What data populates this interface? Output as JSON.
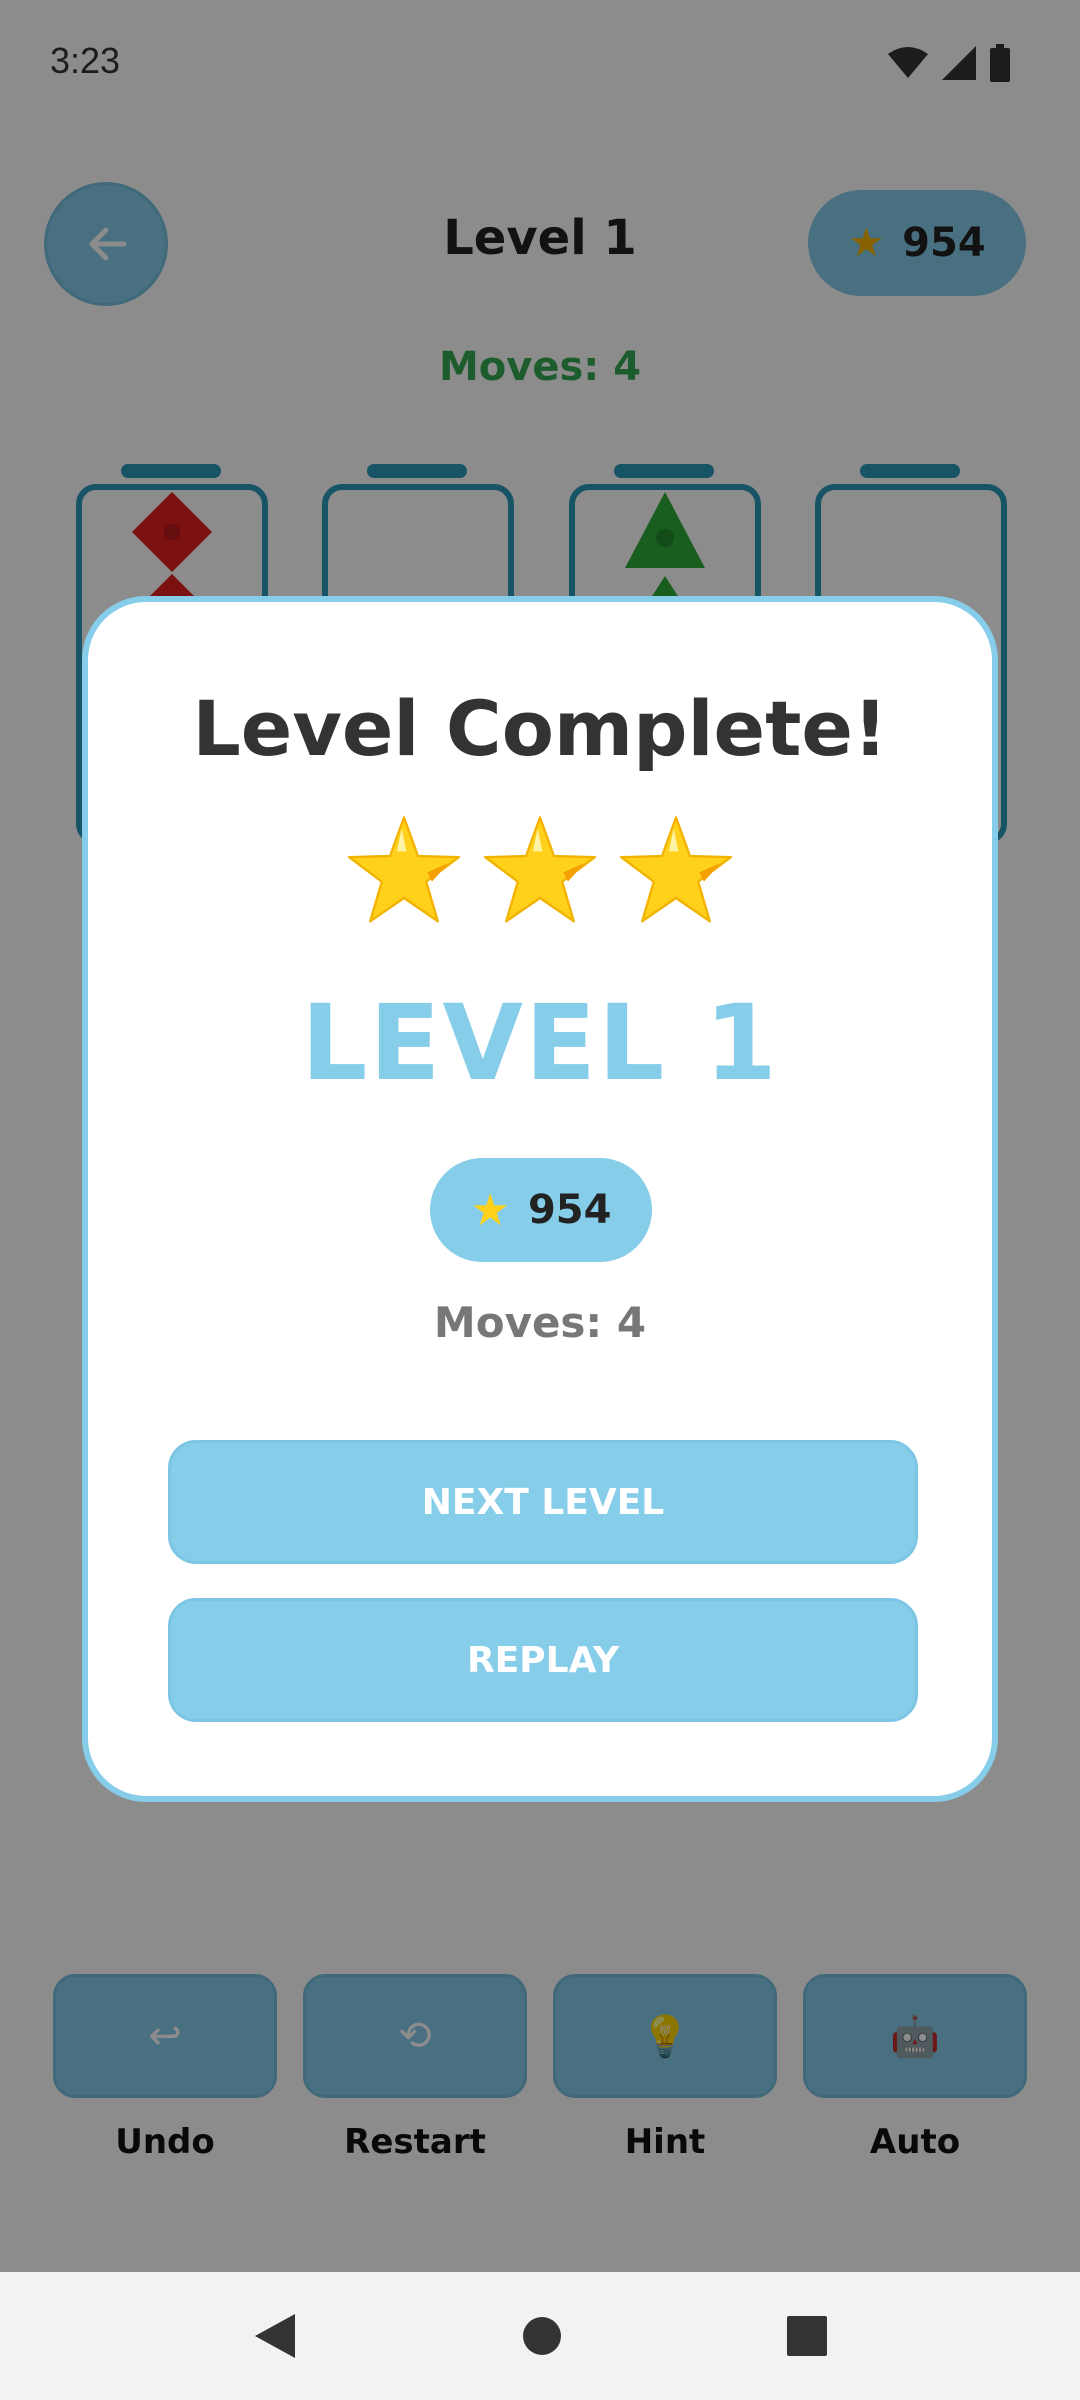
{
  "status_bar": {
    "time": "3:23"
  },
  "header": {
    "title": "Level 1",
    "score": "954"
  },
  "moves_label": "Moves: 4",
  "toolbar": {
    "undo": {
      "icon": "↩",
      "label": "Undo"
    },
    "restart": {
      "icon": "⟲",
      "label": "Restart"
    },
    "hint": {
      "icon": "💡",
      "label": "Hint"
    },
    "auto": {
      "icon": "🤖",
      "label": "Auto"
    }
  },
  "dialog": {
    "title": "Level Complete!",
    "stars_earned": 3,
    "level_label": "LEVEL 1",
    "score": "954",
    "moves": "Moves: 4",
    "next_button": "NEXT LEVEL",
    "replay_button": "REPLAY"
  },
  "colors": {
    "accent": "#86cdea",
    "tube": "#2a9ab8",
    "moves_green": "#34a853",
    "star": "#ffd11a"
  }
}
